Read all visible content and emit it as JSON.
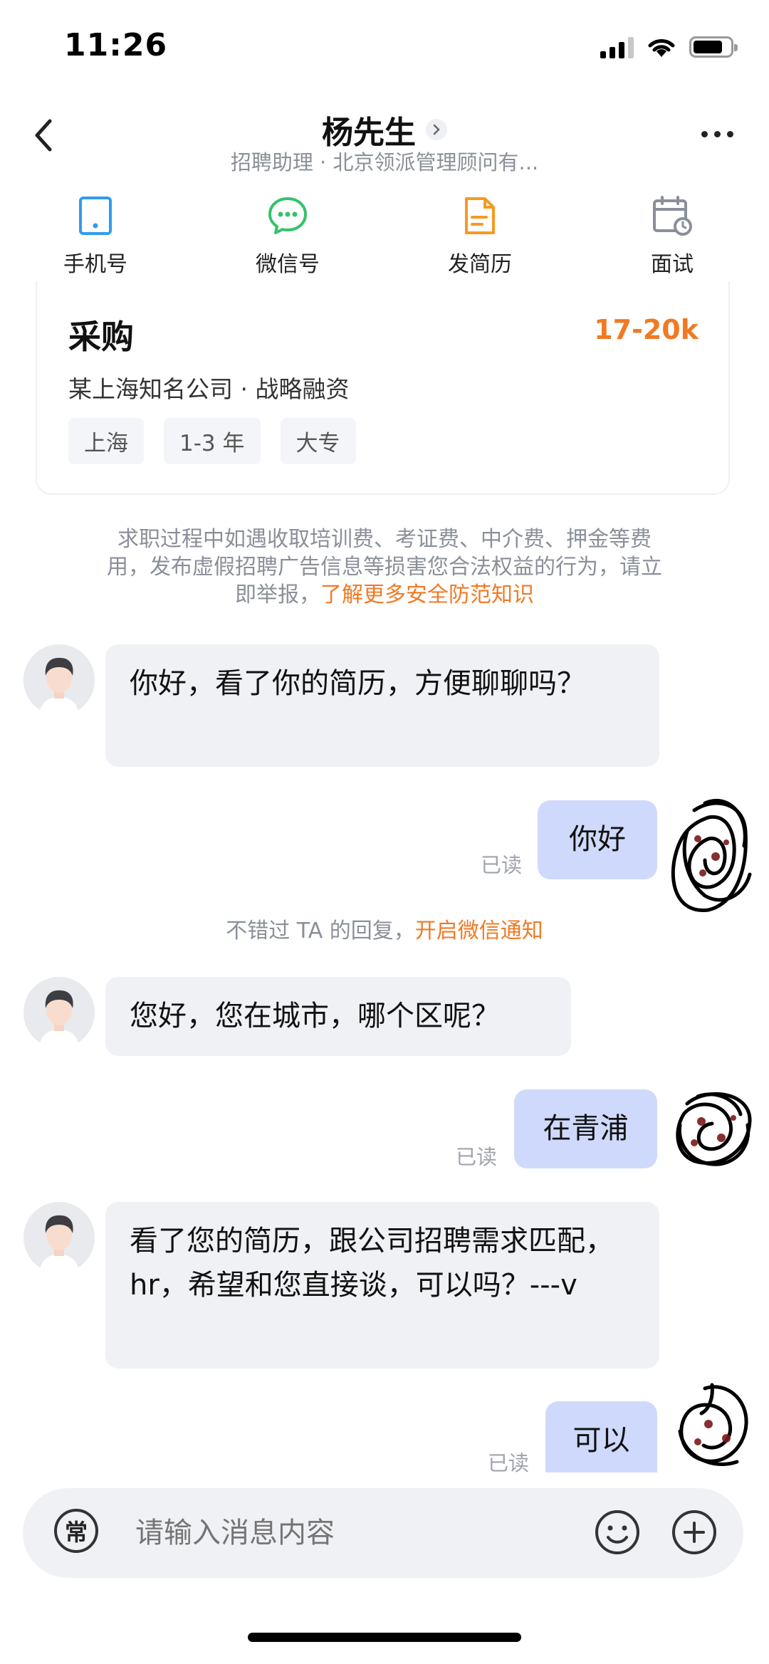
{
  "status_bar": {
    "time": "11:26"
  },
  "header": {
    "title": "杨先生",
    "subtitle": "招聘助理 · 北京领派管理顾问有..."
  },
  "quick_actions": [
    {
      "label": "手机号",
      "icon": "phone-icon",
      "color": "#2f9bf0"
    },
    {
      "label": "微信号",
      "icon": "wechat-icon",
      "color": "#35c26b"
    },
    {
      "label": "发简历",
      "icon": "resume-icon",
      "color": "#f59a23"
    },
    {
      "label": "面试",
      "icon": "calendar-icon",
      "color": "#8a8f99"
    }
  ],
  "job_card": {
    "title": "采购",
    "salary": "17-20k",
    "company": "某上海知名公司 · 战略融资",
    "tags": [
      "上海",
      "1-3 年",
      "大专"
    ]
  },
  "safety_notice": {
    "text": "求职过程中如遇收取培训费、考证费、中介费、押金等费用，发布虚假招聘广告信息等损害您合法权益的行为，请立即举报，",
    "link": "了解更多安全防范知识"
  },
  "messages": [
    {
      "from": "recruiter",
      "text": "你好，看了你的简历，方便聊聊吗？"
    },
    {
      "from": "me",
      "text": "你好",
      "status": "已读"
    },
    {
      "from": "recruiter",
      "text": "您好，您在城市，哪个区呢？"
    },
    {
      "from": "me",
      "text": "在青浦",
      "status": "已读"
    },
    {
      "from": "recruiter",
      "text": "看了您的简历，跟公司招聘需求匹配，hr，希望和您直接谈，可以吗？---v"
    },
    {
      "from": "me",
      "text": "可以",
      "status": "已读"
    }
  ],
  "system_tip": {
    "text": "不错过 TA 的回复，",
    "link": "开启微信通知"
  },
  "input": {
    "common_label": "常",
    "placeholder": "请输入消息内容"
  },
  "colors": {
    "accent": "#f07a24",
    "bubble_out": "#cfd9fb",
    "bubble_in": "#f0f1f5"
  }
}
